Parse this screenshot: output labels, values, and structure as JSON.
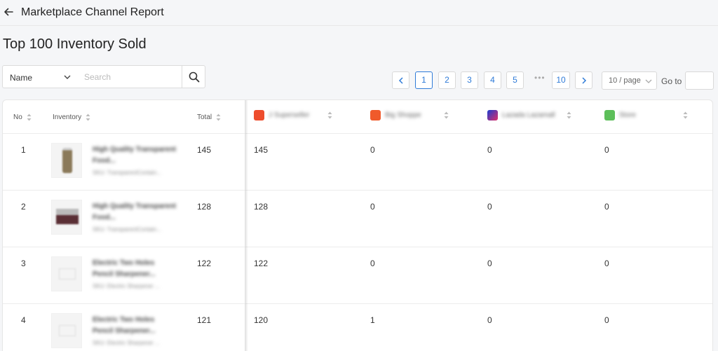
{
  "header": {
    "title": "Marketplace Channel Report"
  },
  "page": {
    "title": "Top 100 Inventory Sold"
  },
  "filter": {
    "field": "Name",
    "search_placeholder": "Search"
  },
  "pagination": {
    "pages": [
      "1",
      "2",
      "3",
      "4",
      "5"
    ],
    "last_page": "10",
    "ellipsis": "•••",
    "per_page": "10 / page",
    "goto_label": "Go to",
    "current": "1"
  },
  "table": {
    "columns": {
      "no": "No",
      "inventory": "Inventory",
      "total": "Total",
      "ch1": "J Superseller",
      "ch2": "Big Shoppe",
      "ch3": "Lazada Lazamall",
      "ch4": "Store"
    },
    "channel_colors": {
      "ch1": "#ee4d2d",
      "ch2": "#f05a2b",
      "ch3": "#5a2fd0",
      "ch4": "#5dbf5a"
    },
    "rows": [
      {
        "no": "1",
        "name": "High Quality Transparent Food...",
        "sku": "SKU: TransparentContain...",
        "total": "145",
        "ch1": "145",
        "ch2": "0",
        "ch3": "0",
        "ch4": "0"
      },
      {
        "no": "2",
        "name": "High Quality Transparent Food...",
        "sku": "SKU: TransparentContain...",
        "total": "128",
        "ch1": "128",
        "ch2": "0",
        "ch3": "0",
        "ch4": "0"
      },
      {
        "no": "3",
        "name": "Electric Two Holes Pencil Sharpener...",
        "sku": "SKU: Electric Sharpener ...",
        "total": "122",
        "ch1": "122",
        "ch2": "0",
        "ch3": "0",
        "ch4": "0"
      },
      {
        "no": "4",
        "name": "Electric Two Holes Pencil Sharpener...",
        "sku": "SKU: Electric Sharpener ...",
        "total": "121",
        "ch1": "120",
        "ch2": "1",
        "ch3": "0",
        "ch4": "0"
      }
    ]
  }
}
